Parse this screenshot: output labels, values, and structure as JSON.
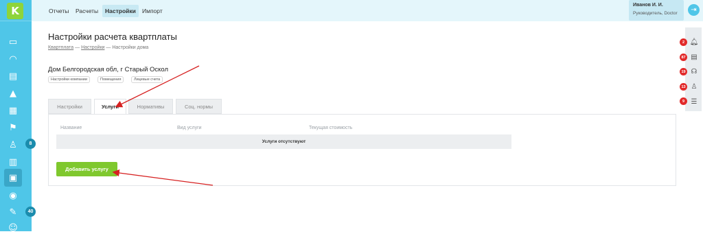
{
  "app": {
    "logo_letter": "K",
    "accent_color": "#4fc6e8",
    "brand_color": "#8ed43b"
  },
  "sidebar": {
    "items": [
      {
        "icon": "wallet-icon"
      },
      {
        "icon": "gauge-icon"
      },
      {
        "icon": "clipboard-icon"
      },
      {
        "icon": "chart-icon"
      },
      {
        "icon": "stack-icon"
      },
      {
        "icon": "flag-icon"
      },
      {
        "icon": "worker-icon",
        "badge": "8"
      },
      {
        "icon": "building-icon"
      },
      {
        "icon": "calculator-icon",
        "active": true
      },
      {
        "icon": "coin-icon"
      },
      {
        "icon": "edit-icon",
        "badge": "40"
      },
      {
        "icon": "smile-icon"
      }
    ]
  },
  "topnav": {
    "items": [
      "Отчеты",
      "Расчеты",
      "Настройки",
      "Импорт"
    ],
    "active": "Настройки"
  },
  "user": {
    "name": "Иванов И. И.",
    "role": "Руководитель, Doctor"
  },
  "page": {
    "title": "Настройки расчета квартплаты",
    "breadcrumb": [
      "Квартплата",
      "Настройки",
      "Настройки дома"
    ],
    "breadcrumb_sep": "—",
    "house": "Дом Белгородская обл, г Старый Оскол",
    "chips": [
      "Настройки компании",
      "Помещения",
      "Лицевые счета"
    ]
  },
  "tabs": {
    "items": [
      "Настройки",
      "Услуги",
      "Нормативы",
      "Соц. нормы"
    ],
    "active": "Услуги"
  },
  "table": {
    "headers": [
      "Название",
      "Вид услуги",
      "Текущая стоимость"
    ],
    "empty": "Услуги отсутствуют"
  },
  "actions": {
    "add_service": "Добавить услугу"
  },
  "right_panel": {
    "items": [
      {
        "icon": "bell-icon",
        "badge": "2"
      },
      {
        "icon": "task-icon",
        "badge": "87"
      },
      {
        "icon": "support-icon",
        "badge": "19"
      },
      {
        "icon": "worker-icon",
        "badge": "13"
      },
      {
        "icon": "chat-icon",
        "badge": "9"
      }
    ],
    "badge_color": "#e22a2a"
  },
  "annotations": {
    "arrow_color": "#d62020"
  }
}
